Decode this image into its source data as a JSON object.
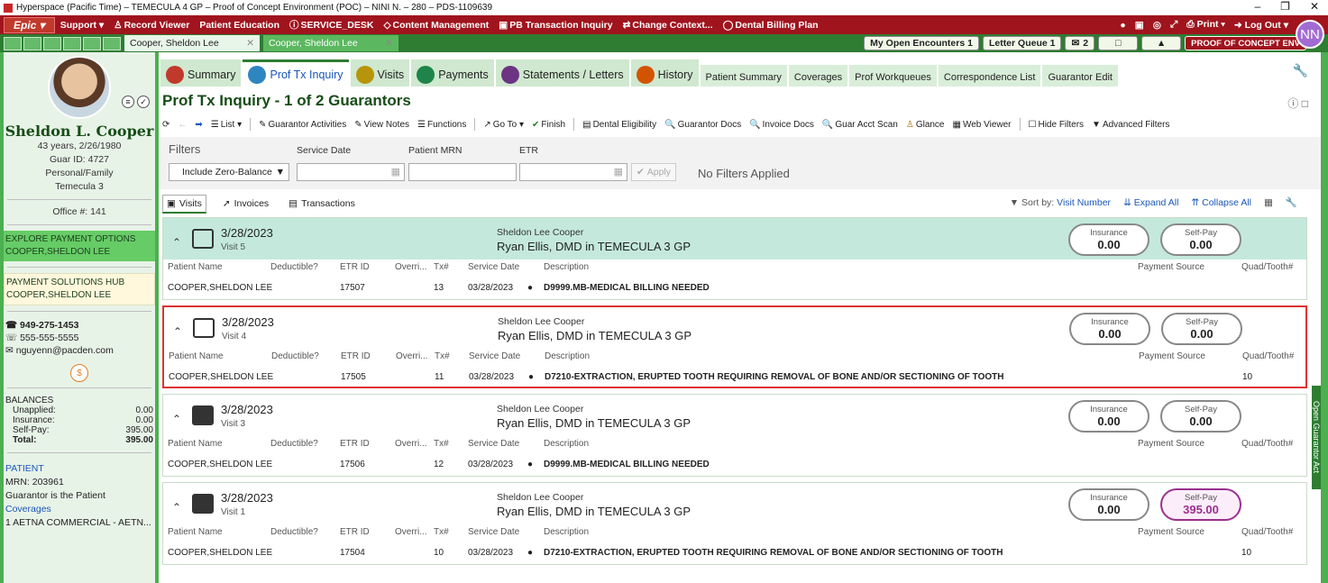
{
  "titlebar": {
    "text": "Hyperspace (Pacific Time) – TEMECULA 4 GP – Proof of Concept Environment (POC) – NINI N. – 280 – PDS-1109639",
    "controls": [
      "–",
      "❐",
      "✕"
    ]
  },
  "menubar": {
    "epic": "Epic ▾",
    "items": [
      "Support ▾",
      "Record Viewer",
      "Patient Education",
      "SERVICE_DESK",
      "Content Management",
      "PB Transaction Inquiry",
      "Change Context...",
      "Dental Billing Plan"
    ],
    "print": "Print ▾",
    "logout": "Log Out ▾"
  },
  "tabbar": {
    "patient_tabs": [
      "Cooper, Sheldon Lee",
      "Cooper, Sheldon Lee"
    ],
    "my_open_encounters": "My Open Encounters 1",
    "letter_queue": "Letter Queue 1",
    "inbox_count": "2",
    "env_label": "PROOF OF CONCEPT ENV",
    "user_initials": "NN"
  },
  "sidebar": {
    "name": "Sheldon L. Cooper",
    "age_dob": "43 years, 2/26/1980",
    "guar_id": "Guar ID: 4727",
    "type": "Personal/Family",
    "location": "Temecula 3",
    "office": "Office #: 141",
    "banner1": [
      "EXPLORE PAYMENT OPTIONS",
      "COOPER,SHELDON LEE"
    ],
    "banner2": [
      "PAYMENT SOLUTIONS HUB",
      "COOPER,SHELDON LEE"
    ],
    "phone_main": "949-275-1453",
    "phone_alt": "555-555-5555",
    "email": "nguyenn@pacden.com",
    "balances": {
      "title": "BALANCES",
      "rows": [
        {
          "label": "Unapplied:",
          "value": "0.00"
        },
        {
          "label": "Insurance:",
          "value": "0.00"
        },
        {
          "label": "Self-Pay:",
          "value": "395.00"
        },
        {
          "label": "Total:",
          "value": "395.00"
        }
      ]
    },
    "patient": {
      "title": "PATIENT",
      "mrn": "MRN: 203961",
      "note": "Guarantor is the Patient",
      "coverages": "Coverages",
      "coverage1": "1  AETNA COMMERCIAL - AETN..."
    }
  },
  "activity_tabs": [
    {
      "label": "Summary",
      "size": "big",
      "color": "#c0392b"
    },
    {
      "label": "Prof Tx Inquiry",
      "size": "big",
      "color": "#2e86c1",
      "active": true
    },
    {
      "label": "Visits",
      "size": "big",
      "color": "#b7950b"
    },
    {
      "label": "Payments",
      "size": "big",
      "color": "#1e8449"
    },
    {
      "label": "Statements / Letters",
      "size": "big",
      "color": "#6c3483"
    },
    {
      "label": "History",
      "size": "big",
      "color": "#d35400"
    },
    {
      "label": "Patient Summary",
      "size": "small"
    },
    {
      "label": "Coverages",
      "size": "small"
    },
    {
      "label": "Prof Workqueues",
      "size": "small"
    },
    {
      "label": "Correspondence List",
      "size": "small"
    },
    {
      "label": "Guarantor Edit",
      "size": "small"
    }
  ],
  "page_title": "Prof Tx Inquiry - 1 of 2 Guarantors",
  "toolbar": [
    "List ▾",
    "Guarantor Activities",
    "View Notes",
    "Functions",
    "Go To ▾",
    "Finish",
    "Dental Eligibility",
    "Guarantor Docs",
    "Invoice Docs",
    "Guar Acct Scan",
    "Glance",
    "Web Viewer",
    "Hide Filters",
    "Advanced Filters"
  ],
  "filters": {
    "label": "Filters",
    "columns": [
      "Service Date",
      "Patient MRN",
      "ETR"
    ],
    "dropdown": "Include Zero-Balance",
    "apply": "Apply",
    "status": "No Filters Applied"
  },
  "subtabs": [
    "Visits",
    "Invoices",
    "Transactions"
  ],
  "sort": {
    "label": "Sort by:",
    "value": "Visit Number",
    "expand": "Expand All",
    "collapse": "Collapse All"
  },
  "columns": [
    "Patient Name",
    "Deductible?",
    "ETR ID",
    "Overri...",
    "Tx#",
    "Service Date",
    "Description",
    "Payment Source",
    "Quad/Tooth#"
  ],
  "visits": [
    {
      "date": "3/28/2023",
      "visit": "Visit 5",
      "patient": "Sheldon Lee Cooper",
      "provider": "Ryan Ellis, DMD in TEMECULA 3 GP",
      "insurance": "0.00",
      "selfpay": "0.00",
      "row": {
        "name": "COOPER,SHELDON LEE",
        "etr": "17507",
        "tx": "13",
        "svc": "03/28/2023",
        "desc": "D9999.MB-MEDICAL BILLING NEEDED",
        "quad": ""
      }
    },
    {
      "date": "3/28/2023",
      "visit": "Visit 4",
      "patient": "Sheldon Lee Cooper",
      "provider": "Ryan Ellis, DMD in TEMECULA 3 GP",
      "insurance": "0.00",
      "selfpay": "0.00",
      "row": {
        "name": "COOPER,SHELDON LEE",
        "etr": "17505",
        "tx": "11",
        "svc": "03/28/2023",
        "desc": "D7210-EXTRACTION, ERUPTED TOOTH REQUIRING REMOVAL OF BONE AND/OR SECTIONING OF TOOTH",
        "quad": "10"
      }
    },
    {
      "date": "3/28/2023",
      "visit": "Visit 3",
      "patient": "Sheldon Lee Cooper",
      "provider": "Ryan Ellis, DMD in TEMECULA 3 GP",
      "insurance": "0.00",
      "selfpay": "0.00",
      "row": {
        "name": "COOPER,SHELDON LEE",
        "etr": "17506",
        "tx": "12",
        "svc": "03/28/2023",
        "desc": "D9999.MB-MEDICAL BILLING NEEDED",
        "quad": ""
      }
    },
    {
      "date": "3/28/2023",
      "visit": "Visit 1",
      "patient": "Sheldon Lee Cooper",
      "provider": "Ryan Ellis, DMD in TEMECULA 3 GP",
      "insurance": "0.00",
      "selfpay": "395.00",
      "row": {
        "name": "COOPER,SHELDON LEE",
        "etr": "17504",
        "tx": "10",
        "svc": "03/28/2023",
        "desc": "D7210-EXTRACTION, ERUPTED TOOTH REQUIRING REMOVAL OF BONE AND/OR SECTIONING OF TOOTH",
        "quad": "10"
      }
    }
  ],
  "labels": {
    "insurance": "Insurance",
    "selfpay": "Self-Pay"
  },
  "rail_label": "Open Guarantor Act"
}
